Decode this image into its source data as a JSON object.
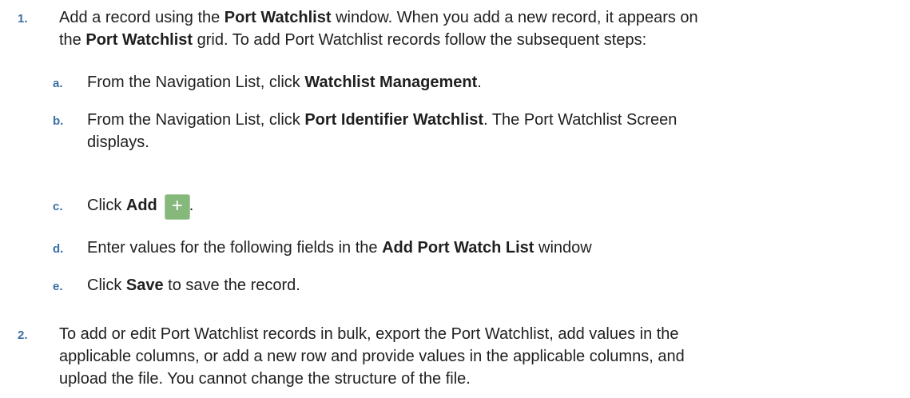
{
  "steps": [
    {
      "number": "1.",
      "line1_pre": "Add a record using the ",
      "line1_b1": "Port Watchlist",
      "line1_post": " window. When you add a new record, it appears on",
      "line2_pre": "the ",
      "line2_b1": "Port Watchlist",
      "line2_post": " grid. To add Port Watchlist records follow the subsequent steps:",
      "substeps": [
        {
          "letter": "a.",
          "pre": "From the Navigation List, click ",
          "bold": "Watchlist Management",
          "post": "."
        },
        {
          "letter": "b.",
          "pre": "From the Navigation List, click ",
          "bold": "Port Identifier Watchlist",
          "post": ". The Port Watchlist Screen",
          "line2": "displays."
        },
        {
          "letter": "c.",
          "pre": "Click ",
          "bold": "Add",
          "icon": "add-plus-icon",
          "icon_glyph": "+",
          "post": "."
        },
        {
          "letter": "d.",
          "pre": "Enter values for the following fields in the ",
          "bold": "Add Port Watch List",
          "post": " window"
        },
        {
          "letter": "e.",
          "pre": "Click ",
          "bold": "Save",
          "post": " to save the record."
        }
      ]
    },
    {
      "number": "2.",
      "lines": [
        "To add or edit Port Watchlist records in bulk, export the Port Watchlist, add values in the",
        "applicable columns, or add a new row and provide values in the applicable columns, and",
        "upload the file. You cannot change the structure of the file."
      ]
    }
  ],
  "colors": {
    "step_number": "#3a6ea5",
    "text": "#1f1f1f",
    "add_icon_bg": "#86b87c"
  }
}
